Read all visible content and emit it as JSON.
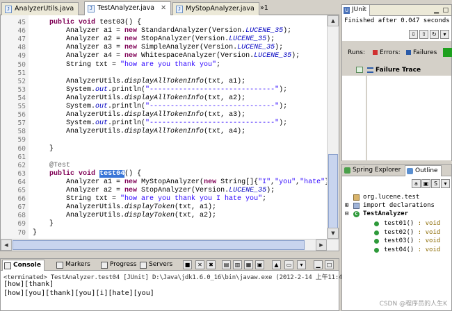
{
  "editor_tabs": [
    {
      "label": "AnalyzerUtils.java",
      "active": false
    },
    {
      "label": "TestAnalyzer.java",
      "active": true,
      "close": "✕"
    },
    {
      "label": "MyStopAnalyzer.java",
      "active": false
    },
    {
      "label": "»1",
      "active": false
    }
  ],
  "line_numbers": [
    "45",
    "46",
    "47",
    "48",
    "49",
    "50",
    "51",
    "52",
    "53",
    "54",
    "55",
    "56",
    "57",
    "58",
    "59",
    "60",
    "61",
    "62",
    "63",
    "64",
    "65",
    "66",
    "67",
    "68",
    "69",
    "70"
  ],
  "code_lines": [
    {
      "html": "    <span class=\"kw\">public</span> <span class=\"kw\">void</span> test03() {"
    },
    {
      "html": "        Analyzer a1 = <span class=\"kw\">new</span> StandardAnalyzer(Version.<span class=\"fld\">LUCENE_35</span>);"
    },
    {
      "html": "        Analyzer a2 = <span class=\"kw\">new</span> StopAnalyzer(Version.<span class=\"fld\">LUCENE_35</span>);"
    },
    {
      "html": "        Analyzer a3 = <span class=\"kw\">new</span> SimpleAnalyzer(Version.<span class=\"fld\">LUCENE_35</span>);"
    },
    {
      "html": "        Analyzer a4 = <span class=\"kw\">new</span> WhitespaceAnalyzer(Version.<span class=\"fld\">LUCENE_35</span>);"
    },
    {
      "html": "        String txt = <span class=\"str\">\"how are you thank you\"</span>;"
    },
    {
      "html": ""
    },
    {
      "html": "        AnalyzerUtils.<span class=\"mth\">displayAllTokenInfo</span>(txt, a1);"
    },
    {
      "html": "        System.<span class=\"fld\">out</span>.println(<span class=\"str\">\"------------------------------\"</span>);"
    },
    {
      "html": "        AnalyzerUtils.<span class=\"mth\">displayAllTokenInfo</span>(txt, a2);"
    },
    {
      "html": "        System.<span class=\"fld\">out</span>.println(<span class=\"str\">\"------------------------------\"</span>);"
    },
    {
      "html": "        AnalyzerUtils.<span class=\"mth\">displayAllTokenInfo</span>(txt, a3);"
    },
    {
      "html": "        System.<span class=\"fld\">out</span>.println(<span class=\"str\">\"------------------------------\"</span>);"
    },
    {
      "html": "        AnalyzerUtils.<span class=\"mth\">displayAllTokenInfo</span>(txt, a4);"
    },
    {
      "html": ""
    },
    {
      "html": "    }"
    },
    {
      "html": ""
    },
    {
      "html": "    <span class=\"ann\">@Test</span>"
    },
    {
      "html": "    <span class=\"kw\">public</span> <span class=\"kw\">void</span> <span class=\"sel\">test04</span>() {"
    },
    {
      "html": "        Analyzer a1 = <span class=\"kw\">new</span> MyStopAnalyzer(<span class=\"kw\">new</span> String[]{<span class=\"str\">\"I\"</span>,<span class=\"str\">\"you\"</span>,<span class=\"str\">\"hate\"</span>});"
    },
    {
      "html": "        Analyzer a2 = <span class=\"kw\">new</span> StopAnalyzer(Version.<span class=\"fld\">LUCENE_35</span>);"
    },
    {
      "html": "        String txt = <span class=\"str\">\"how are you thank you I hate you\"</span>;"
    },
    {
      "html": "        AnalyzerUtils.<span class=\"mth\">displayToken</span>(txt, a1);"
    },
    {
      "html": "        AnalyzerUtils.<span class=\"mth\">displayToken</span>(txt, a2);"
    },
    {
      "html": "    }"
    },
    {
      "html": "}"
    }
  ],
  "console": {
    "tabs": [
      "Console",
      "Markers",
      "Progress",
      "Servers"
    ],
    "status": "<terminated> TestAnalyzer.test04 [JUnit] D:\\Java\\jdk1.6.0_16\\bin\\javaw.exe (2012-2-14 上午11:43:58)",
    "output": [
      "[how][thank]",
      "[how][you][thank][you][i][hate][you]"
    ]
  },
  "junit": {
    "tab": "JUnit",
    "finished": "Finished after 0.047 seconds",
    "runs_label": "Runs:",
    "errors_label": "Errors:",
    "failures_label": "Failures",
    "failure_trace": "Failure Trace",
    "bar_color": "#1ea01e"
  },
  "outline": {
    "tabs": [
      "Spring Explorer",
      "Outline"
    ],
    "package": "org.lucene.test",
    "imports": "import declarations",
    "class": "TestAnalyzer",
    "methods": [
      "test01",
      "test02",
      "test03",
      "test04"
    ],
    "return_suffix": " : void"
  },
  "watermark": "CSDN @程序员的人生K"
}
